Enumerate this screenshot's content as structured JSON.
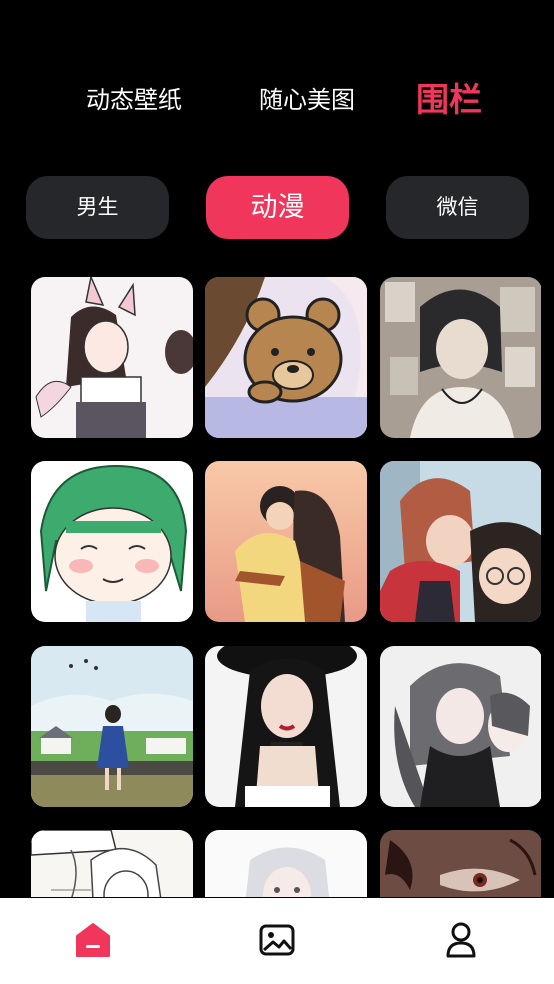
{
  "top_tabs": [
    {
      "label": "动态壁纸"
    },
    {
      "label": "随心美图"
    },
    {
      "label": "围栏"
    }
  ],
  "chips": [
    {
      "label": "男生"
    },
    {
      "label": "动漫"
    },
    {
      "label": "微信"
    }
  ],
  "grid": {
    "items": [
      {
        "icon": "anime-cat-girl-image"
      },
      {
        "icon": "teddy-bear-image"
      },
      {
        "icon": "dark-hair-boy-image"
      },
      {
        "icon": "green-hair-chibi-image"
      },
      {
        "icon": "hugging-couple-image"
      },
      {
        "icon": "anime-couple-image"
      },
      {
        "icon": "girl-by-river-image"
      },
      {
        "icon": "black-hair-woman-image"
      },
      {
        "icon": "gray-hair-anime-image"
      },
      {
        "icon": "sketch-boy-image"
      },
      {
        "icon": "white-hair-girl-image"
      },
      {
        "icon": "dark-eyes-closeup-image"
      }
    ]
  },
  "bottom_nav": [
    {
      "icon": "home-icon",
      "active": true
    },
    {
      "icon": "gallery-icon",
      "active": false
    },
    {
      "icon": "profile-icon",
      "active": false
    }
  ],
  "colors": {
    "accent": "#f0365b",
    "background": "#000000",
    "chip_bg": "#26272b"
  }
}
